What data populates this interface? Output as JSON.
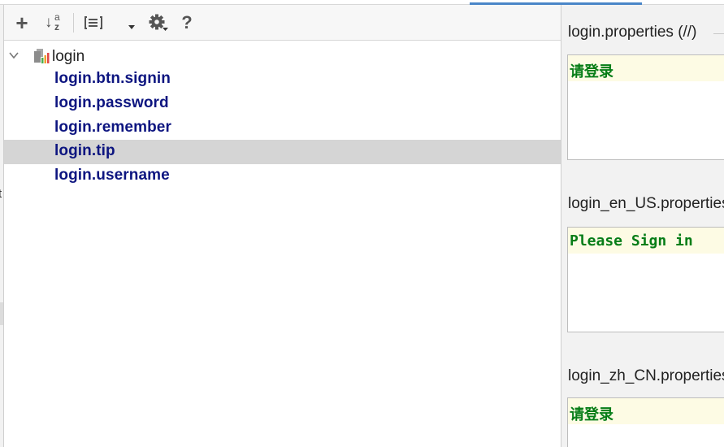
{
  "toolbar": {
    "add_label": "+",
    "sort_label": "↓",
    "sort_sup": "a",
    "sort_sub": "z",
    "help_label": "?",
    "icons": [
      "add-icon",
      "sort-alphabetically-icon",
      "group-by-icon",
      "dropdown-arrow-icon",
      "gear-icon",
      "help-icon"
    ]
  },
  "tree": {
    "root_label": "login",
    "items": [
      {
        "label": "login.btn.signin"
      },
      {
        "label": "login.password"
      },
      {
        "label": "login.remember"
      },
      {
        "label": "login.tip",
        "selected": true
      },
      {
        "label": "login.username"
      }
    ]
  },
  "editors": [
    {
      "file": "login.properties (//)",
      "value": "请登录"
    },
    {
      "file": "login_en_US.properties",
      "value": "Please Sign in"
    },
    {
      "file": "login_zh_CN.properties",
      "value": "请登录"
    }
  ],
  "gutter": {
    "char": "t"
  },
  "colors": {
    "key_text": "#0d1580",
    "value_text": "#067d17",
    "selection": "#d5d5d5",
    "value_highlight": "#fdfbe4",
    "tab_indicator": "#4a86c8"
  }
}
